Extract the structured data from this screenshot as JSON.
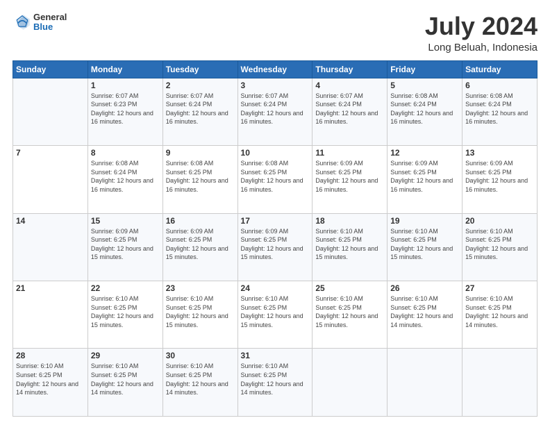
{
  "logo": {
    "general": "General",
    "blue": "Blue"
  },
  "header": {
    "month_year": "July 2024",
    "location": "Long Beluah, Indonesia"
  },
  "days_of_week": [
    "Sunday",
    "Monday",
    "Tuesday",
    "Wednesday",
    "Thursday",
    "Friday",
    "Saturday"
  ],
  "weeks": [
    [
      {
        "day": "",
        "info": ""
      },
      {
        "day": "1",
        "info": "Sunrise: 6:07 AM\nSunset: 6:23 PM\nDaylight: 12 hours and 16 minutes."
      },
      {
        "day": "2",
        "info": "Sunrise: 6:07 AM\nSunset: 6:24 PM\nDaylight: 12 hours and 16 minutes."
      },
      {
        "day": "3",
        "info": "Sunrise: 6:07 AM\nSunset: 6:24 PM\nDaylight: 12 hours and 16 minutes."
      },
      {
        "day": "4",
        "info": "Sunrise: 6:07 AM\nSunset: 6:24 PM\nDaylight: 12 hours and 16 minutes."
      },
      {
        "day": "5",
        "info": "Sunrise: 6:08 AM\nSunset: 6:24 PM\nDaylight: 12 hours and 16 minutes."
      },
      {
        "day": "6",
        "info": "Sunrise: 6:08 AM\nSunset: 6:24 PM\nDaylight: 12 hours and 16 minutes."
      }
    ],
    [
      {
        "day": "7",
        "info": ""
      },
      {
        "day": "8",
        "info": "Sunrise: 6:08 AM\nSunset: 6:24 PM\nDaylight: 12 hours and 16 minutes."
      },
      {
        "day": "9",
        "info": "Sunrise: 6:08 AM\nSunset: 6:25 PM\nDaylight: 12 hours and 16 minutes."
      },
      {
        "day": "10",
        "info": "Sunrise: 6:08 AM\nSunset: 6:25 PM\nDaylight: 12 hours and 16 minutes."
      },
      {
        "day": "11",
        "info": "Sunrise: 6:09 AM\nSunset: 6:25 PM\nDaylight: 12 hours and 16 minutes."
      },
      {
        "day": "12",
        "info": "Sunrise: 6:09 AM\nSunset: 6:25 PM\nDaylight: 12 hours and 16 minutes."
      },
      {
        "day": "13",
        "info": "Sunrise: 6:09 AM\nSunset: 6:25 PM\nDaylight: 12 hours and 16 minutes."
      }
    ],
    [
      {
        "day": "14",
        "info": ""
      },
      {
        "day": "15",
        "info": "Sunrise: 6:09 AM\nSunset: 6:25 PM\nDaylight: 12 hours and 15 minutes."
      },
      {
        "day": "16",
        "info": "Sunrise: 6:09 AM\nSunset: 6:25 PM\nDaylight: 12 hours and 15 minutes."
      },
      {
        "day": "17",
        "info": "Sunrise: 6:09 AM\nSunset: 6:25 PM\nDaylight: 12 hours and 15 minutes."
      },
      {
        "day": "18",
        "info": "Sunrise: 6:10 AM\nSunset: 6:25 PM\nDaylight: 12 hours and 15 minutes."
      },
      {
        "day": "19",
        "info": "Sunrise: 6:10 AM\nSunset: 6:25 PM\nDaylight: 12 hours and 15 minutes."
      },
      {
        "day": "20",
        "info": "Sunrise: 6:10 AM\nSunset: 6:25 PM\nDaylight: 12 hours and 15 minutes."
      }
    ],
    [
      {
        "day": "21",
        "info": ""
      },
      {
        "day": "22",
        "info": "Sunrise: 6:10 AM\nSunset: 6:25 PM\nDaylight: 12 hours and 15 minutes."
      },
      {
        "day": "23",
        "info": "Sunrise: 6:10 AM\nSunset: 6:25 PM\nDaylight: 12 hours and 15 minutes."
      },
      {
        "day": "24",
        "info": "Sunrise: 6:10 AM\nSunset: 6:25 PM\nDaylight: 12 hours and 15 minutes."
      },
      {
        "day": "25",
        "info": "Sunrise: 6:10 AM\nSunset: 6:25 PM\nDaylight: 12 hours and 15 minutes."
      },
      {
        "day": "26",
        "info": "Sunrise: 6:10 AM\nSunset: 6:25 PM\nDaylight: 12 hours and 14 minutes."
      },
      {
        "day": "27",
        "info": "Sunrise: 6:10 AM\nSunset: 6:25 PM\nDaylight: 12 hours and 14 minutes."
      }
    ],
    [
      {
        "day": "28",
        "info": "Sunrise: 6:10 AM\nSunset: 6:25 PM\nDaylight: 12 hours and 14 minutes."
      },
      {
        "day": "29",
        "info": "Sunrise: 6:10 AM\nSunset: 6:25 PM\nDaylight: 12 hours and 14 minutes."
      },
      {
        "day": "30",
        "info": "Sunrise: 6:10 AM\nSunset: 6:25 PM\nDaylight: 12 hours and 14 minutes."
      },
      {
        "day": "31",
        "info": "Sunrise: 6:10 AM\nSunset: 6:25 PM\nDaylight: 12 hours and 14 minutes."
      },
      {
        "day": "",
        "info": ""
      },
      {
        "day": "",
        "info": ""
      },
      {
        "day": "",
        "info": ""
      }
    ]
  ]
}
